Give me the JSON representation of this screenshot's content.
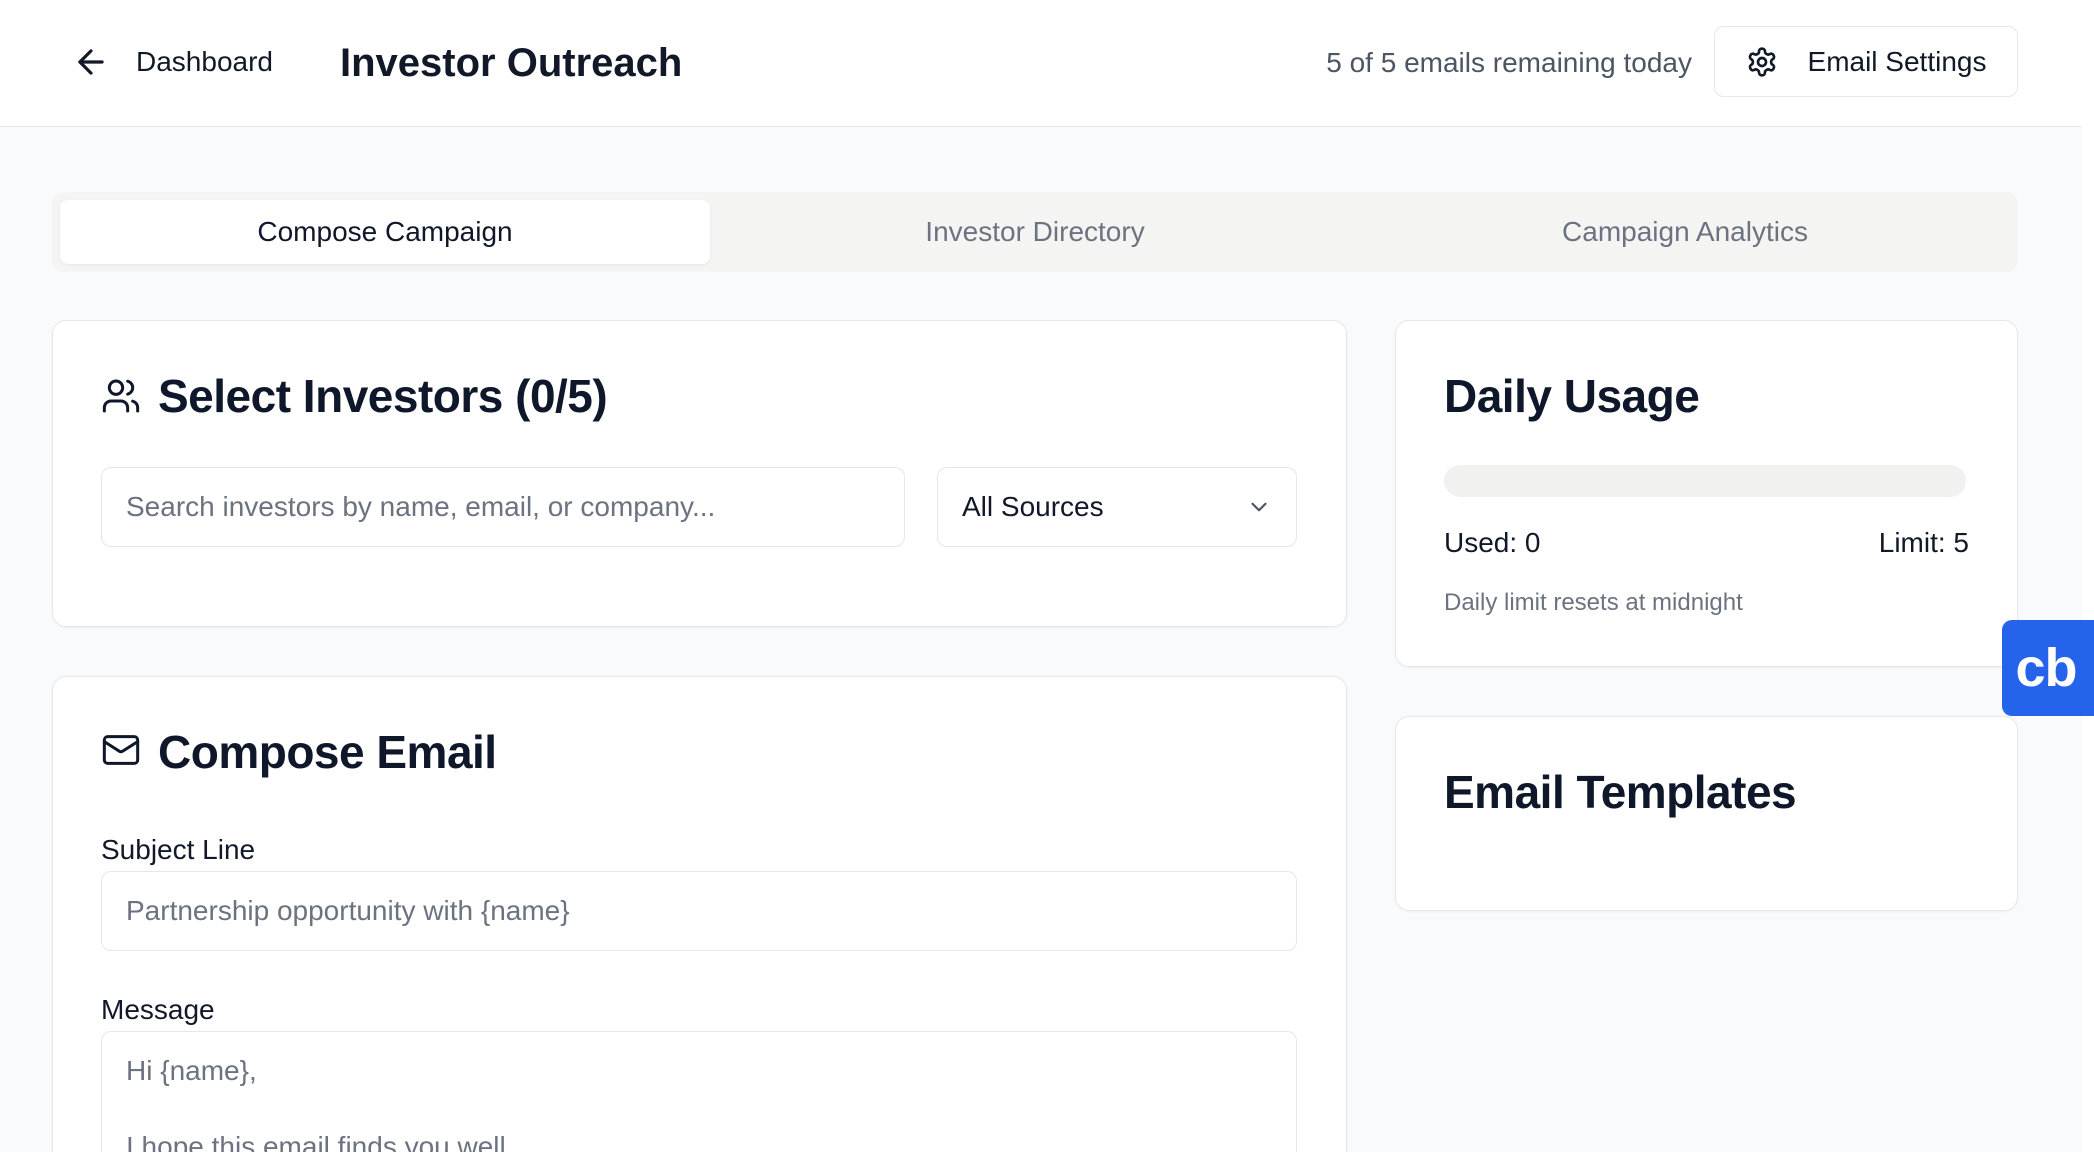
{
  "header": {
    "back_label": "Dashboard",
    "title": "Investor Outreach",
    "remaining_text": "5 of 5 emails remaining today",
    "settings_label": "Email Settings"
  },
  "tabs": [
    {
      "label": "Compose Campaign",
      "active": true
    },
    {
      "label": "Investor Directory",
      "active": false
    },
    {
      "label": "Campaign Analytics",
      "active": false
    }
  ],
  "select_investors": {
    "title": "Select Investors (0/5)",
    "icon": "users-icon",
    "search_placeholder": "Search investors by name, email, or company...",
    "source_filter": "All Sources"
  },
  "compose_email": {
    "title": "Compose Email",
    "icon": "mail-icon",
    "subject_label": "Subject Line",
    "subject_placeholder": "Partnership opportunity with {name}",
    "message_label": "Message",
    "message_placeholder": "Hi {name},\n\nI hope this email finds you well."
  },
  "daily_usage": {
    "title": "Daily Usage",
    "used_label": "Used: 0",
    "limit_label": "Limit: 5",
    "used_fraction": 0,
    "reset_note": "Daily limit resets at midnight"
  },
  "email_templates": {
    "title": "Email Templates"
  },
  "badge": {
    "text": "cb",
    "color": "#2563eb"
  },
  "colors": {
    "primary": "#0f172a",
    "muted": "#6b7280",
    "border": "#e5e7eb",
    "background": "#f9fafb"
  }
}
